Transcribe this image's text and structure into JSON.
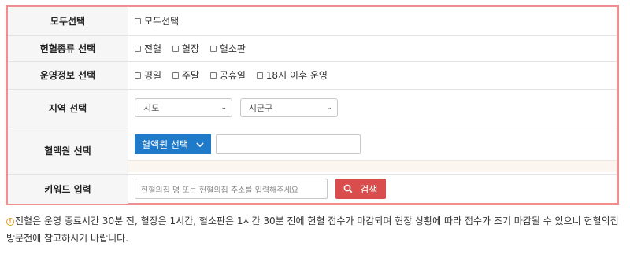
{
  "rows": {
    "select_all": {
      "label": "모두선택",
      "options": [
        "모두선택"
      ]
    },
    "blood_type": {
      "label": "헌혈종류 선택",
      "options": [
        "전혈",
        "혈장",
        "혈소판"
      ]
    },
    "operation": {
      "label": "운영정보 선택",
      "options": [
        "평일",
        "주말",
        "공휴일",
        "18시 이후 운영"
      ]
    },
    "region": {
      "label": "지역 선택",
      "sido": "시도",
      "sigungu": "시군구"
    },
    "blood_center": {
      "label": "혈액원 선택",
      "button": "혈액원 선택"
    },
    "keyword": {
      "label": "키워드 입력",
      "placeholder": "헌혈의집 명 또는 헌혈의집 주소를 입력해주세요",
      "search_button": "검색"
    }
  },
  "notice": {
    "text": "전혈은 운영 종료시간 30분 전, 혈장은 1시간, 혈소판은 1시간 30분 전에 헌혈 접수가 마감되며 현장 상황에 따라 접수가 조기 마감될 수 있으니 헌혈의집 방문전에 참고하시기 바랍니다."
  },
  "colors": {
    "frame_border": "#ef8f8f",
    "header_bg": "#f6f6f6",
    "blood_center_button": "#1f7ac9",
    "search_button": "#d94d4d",
    "info_icon": "#e0a020"
  },
  "icons": {
    "chevron": "chevron-down-icon",
    "search": "search-icon",
    "info": "info-icon"
  }
}
